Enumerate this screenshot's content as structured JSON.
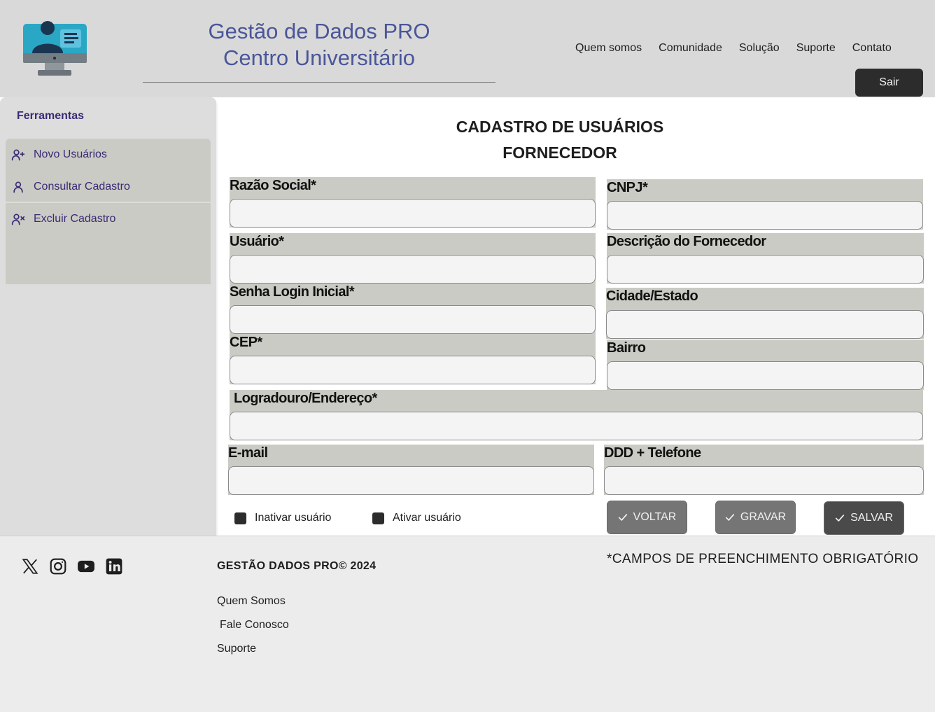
{
  "header": {
    "brand_line1": "Gestão de Dados PRO",
    "brand_line2": "Centro Universitário",
    "nav": [
      "Quem somos",
      "Comunidade",
      "Solução",
      "Suporte",
      "Contato"
    ],
    "logout_label": "Sair",
    "logo_icon": "computer-user-icon"
  },
  "sidebar": {
    "title": "Ferramentas",
    "items": [
      {
        "label": "Novo Usuários",
        "icon": "user-plus-icon"
      },
      {
        "label": "Consultar Cadastro",
        "icon": "user-icon"
      },
      {
        "label": "Excluir Cadastro",
        "icon": "user-x-icon"
      }
    ]
  },
  "form": {
    "title": "CADASTRO DE USUÁRIOS",
    "subtitle": "FORNECEDOR",
    "fields": {
      "razao_social": {
        "label": "Razão Social*",
        "value": ""
      },
      "cnpj": {
        "label": "CNPJ*",
        "value": ""
      },
      "usuario": {
        "label": "Usuário*",
        "value": ""
      },
      "descricao": {
        "label": "Descrição do Fornecedor",
        "value": ""
      },
      "senha": {
        "label": "Senha Login Inicial*",
        "value": ""
      },
      "cidade": {
        "label": "Cidade/Estado",
        "value": ""
      },
      "cep": {
        "label": "CEP*",
        "value": ""
      },
      "bairro": {
        "label": "Bairro",
        "value": ""
      },
      "logradouro": {
        "label": "Logradouro/Endereço*",
        "value": ""
      },
      "email": {
        "label": "E-mail",
        "value": ""
      },
      "telefone": {
        "label": "DDD + Telefone",
        "value": ""
      }
    },
    "checkboxes": {
      "inativar": "Inativar usuário",
      "ativar": "Ativar usuário"
    },
    "buttons": {
      "voltar": "VOLTAR",
      "gravar": "GRAVAR",
      "salvar": "SALVAR"
    }
  },
  "footer": {
    "copyright": "GESTÃO DADOS PRO© 2024",
    "required_note": "*CAMPOS DE PREENCHIMENTO OBRIGATÓRIO",
    "links": [
      "Quem Somos",
      "Fale Conosco",
      "Suporte"
    ],
    "social": [
      "x-icon",
      "instagram-icon",
      "youtube-icon",
      "linkedin-icon"
    ]
  },
  "colors": {
    "header_bg": "#d9d9d9",
    "brand_text": "#4a5699",
    "sidebar_text": "#3a2a74",
    "field_bg": "#cbcbc5",
    "button_dark": "#2c2c2c",
    "button_gray": "#757575"
  }
}
